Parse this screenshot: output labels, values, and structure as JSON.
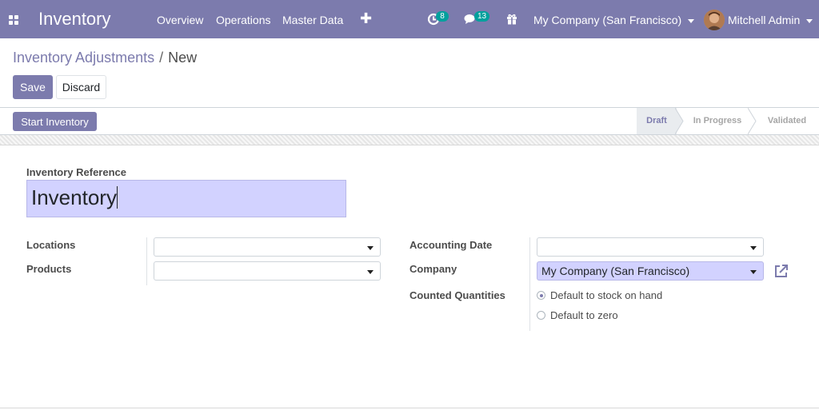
{
  "navbar": {
    "app_title": "Inventory",
    "menu": [
      "Overview",
      "Operations",
      "Master Data"
    ],
    "activities_count": "8",
    "messages_count": "13",
    "company": "My Company (San Francisco)",
    "user": "Mitchell Admin",
    "bg_color": "#7c7bad",
    "badge_color": "#00a09d"
  },
  "breadcrumb": {
    "parent": "Inventory Adjustments",
    "current": "New"
  },
  "buttons": {
    "save": "Save",
    "discard": "Discard",
    "start": "Start Inventory"
  },
  "stages": [
    "Draft",
    "In Progress",
    "Validated"
  ],
  "form": {
    "reference_label": "Inventory Reference",
    "reference_value": "Inventory",
    "locations_label": "Locations",
    "products_label": "Products",
    "accounting_date_label": "Accounting Date",
    "company_label": "Company",
    "company_value": "My Company (San Francisco)",
    "counted_label": "Counted Quantities",
    "counted_options": [
      "Default to stock on hand",
      "Default to zero"
    ]
  },
  "icons": {
    "apps": "apps-grid-icon",
    "plus": "plus-icon",
    "activity": "clock-icon",
    "messages": "chat-icon",
    "gift": "gift-icon",
    "external": "external-link-icon"
  }
}
